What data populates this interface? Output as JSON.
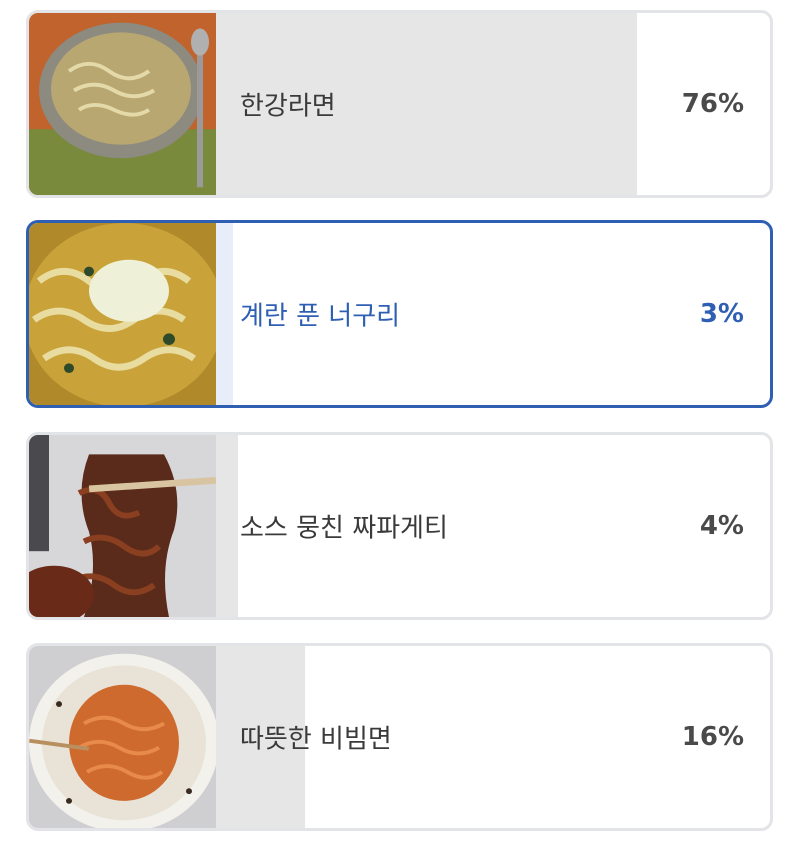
{
  "poll": {
    "options": [
      {
        "label": "한강라면",
        "percent_text": "76%",
        "share": 0.76,
        "selected": false,
        "image": "ramen-bowl-photo"
      },
      {
        "label": "계란 푼 너구리",
        "percent_text": "3%",
        "share": 0.03,
        "selected": true,
        "image": "egg-noodle-photo"
      },
      {
        "label": "소스 뭉친 짜파게티",
        "percent_text": "4%",
        "share": 0.04,
        "selected": false,
        "image": "black-bean-noodle-photo"
      },
      {
        "label": "따뜻한 비빔면",
        "percent_text": "16%",
        "share": 0.16,
        "selected": false,
        "image": "spicy-noodle-bowl-photo"
      }
    ]
  },
  "colors": {
    "accent": "#2f5fb3",
    "bar": "#e6e6e6",
    "bar_selected": "#e8eef9",
    "border": "#e3e4e7"
  }
}
